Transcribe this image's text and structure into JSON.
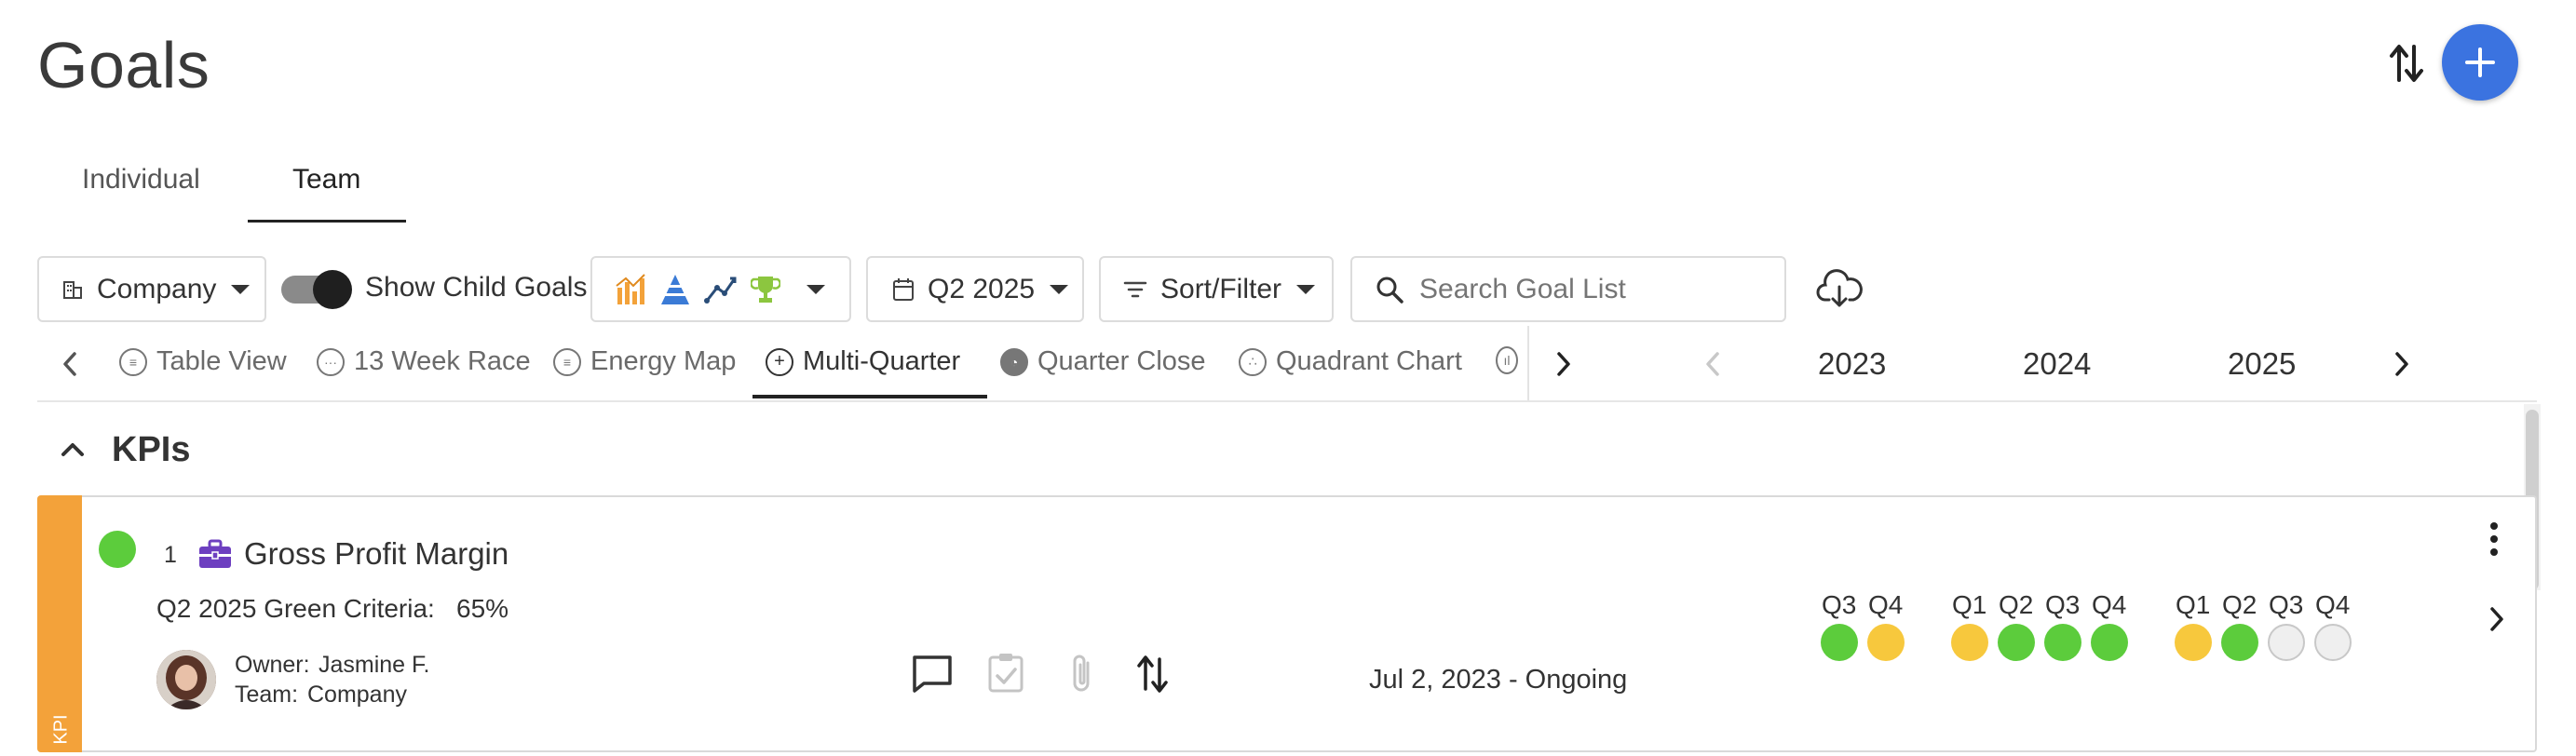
{
  "page": {
    "title": "Goals"
  },
  "tabs": {
    "individual": "Individual",
    "team": "Team"
  },
  "toolbar": {
    "company_label": "Company",
    "show_child_goals": "Show Child Goals",
    "period_label": "Q2 2025",
    "sort_filter_label": "Sort/Filter",
    "search_placeholder": "Search Goal List"
  },
  "views": [
    {
      "label": "Table View",
      "icon": "table-icon"
    },
    {
      "label": "13 Week Race",
      "icon": "race-icon"
    },
    {
      "label": "Energy Map",
      "icon": "energy-map-icon"
    },
    {
      "label": "Multi-Quarter",
      "icon": "plus-circle-icon"
    },
    {
      "label": "Quarter Close",
      "icon": "quarter-close-icon"
    },
    {
      "label": "Quadrant Chart",
      "icon": "quadrant-icon"
    }
  ],
  "years": [
    "2023",
    "2024",
    "2025"
  ],
  "section": {
    "title": "KPIs"
  },
  "goal": {
    "number": "1",
    "name": "Gross Profit Margin",
    "criteria_label": "Q2 2025 Green Criteria:",
    "criteria_value": "65%",
    "owner_label": "Owner:",
    "owner_value": "Jasmine F.",
    "team_label": "Team:",
    "team_value": "Company",
    "dates": "Jul 2, 2023 - Ongoing",
    "strip_label": "KPI",
    "status_color": "#5ccc3c",
    "quarters": [
      {
        "q": "Q3",
        "status": "green"
      },
      {
        "q": "Q4",
        "status": "yellow"
      },
      {
        "q": "Q1",
        "status": "yellow"
      },
      {
        "q": "Q2",
        "status": "green"
      },
      {
        "q": "Q3",
        "status": "green"
      },
      {
        "q": "Q4",
        "status": "green"
      },
      {
        "q": "Q1",
        "status": "yellow"
      },
      {
        "q": "Q2",
        "status": "green"
      },
      {
        "q": "Q3",
        "status": "empty"
      },
      {
        "q": "Q4",
        "status": "empty"
      }
    ]
  },
  "colors": {
    "accent": "#3b73e0",
    "green": "#5ccc3c",
    "yellow": "#f7c83d",
    "kpi_strip": "#f3a23a"
  }
}
